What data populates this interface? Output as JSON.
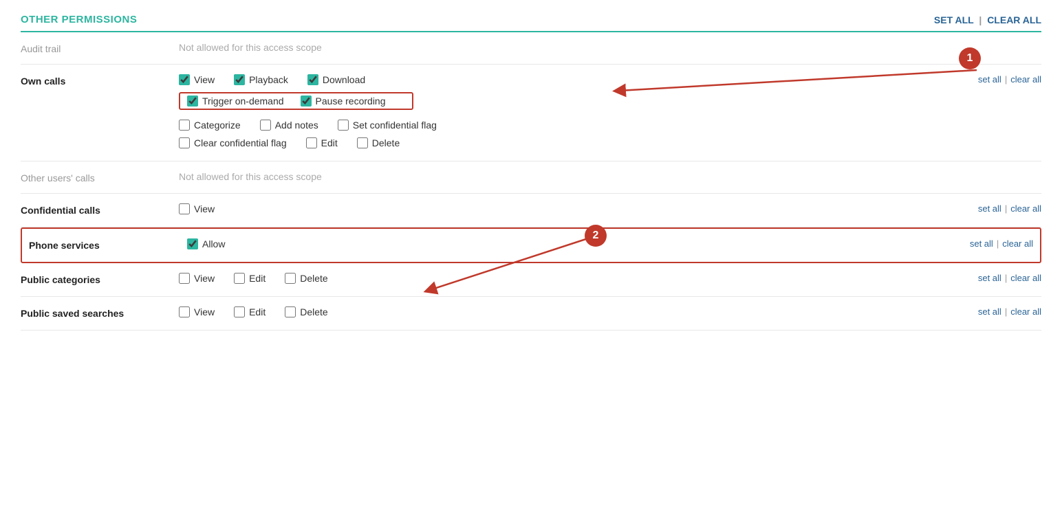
{
  "section": {
    "title": "OTHER PERMISSIONS",
    "set_all_label": "SET ALL",
    "clear_all_label": "CLEAR ALL",
    "divider": "|"
  },
  "rows": [
    {
      "id": "audit-trail",
      "label": "Audit trail",
      "label_style": "muted",
      "not_allowed": true,
      "not_allowed_text": "Not allowed for this access scope",
      "checkboxes": [],
      "has_actions": false
    },
    {
      "id": "own-calls",
      "label": "Own calls",
      "label_style": "bold",
      "not_allowed": false,
      "checkboxes": [
        {
          "id": "oc-view",
          "label": "View",
          "checked": true
        },
        {
          "id": "oc-playback",
          "label": "Playback",
          "checked": true
        },
        {
          "id": "oc-download",
          "label": "Download",
          "checked": true
        },
        {
          "id": "oc-trigger",
          "label": "Trigger on-demand",
          "checked": true,
          "highlight": true
        },
        {
          "id": "oc-pause",
          "label": "Pause recording",
          "checked": true,
          "highlight": true
        },
        {
          "id": "oc-categorize",
          "label": "Categorize",
          "checked": false
        },
        {
          "id": "oc-addnotes",
          "label": "Add notes",
          "checked": false
        },
        {
          "id": "oc-setconfidential",
          "label": "Set confidential flag",
          "checked": false
        },
        {
          "id": "oc-clearconfidential",
          "label": "Clear confidential flag",
          "checked": false
        },
        {
          "id": "oc-edit",
          "label": "Edit",
          "checked": false
        },
        {
          "id": "oc-delete",
          "label": "Delete",
          "checked": false
        }
      ],
      "has_actions": true,
      "set_all": "set all",
      "clear_all": "clear all"
    },
    {
      "id": "other-users-calls",
      "label": "Other users' calls",
      "label_style": "muted",
      "not_allowed": true,
      "not_allowed_text": "Not allowed for this access scope",
      "checkboxes": [],
      "has_actions": false
    },
    {
      "id": "confidential-calls",
      "label": "Confidential calls",
      "label_style": "bold",
      "not_allowed": false,
      "checkboxes": [
        {
          "id": "cc-view",
          "label": "View",
          "checked": false
        }
      ],
      "has_actions": true,
      "set_all": "set all",
      "clear_all": "clear all"
    },
    {
      "id": "phone-services",
      "label": "Phone services",
      "label_style": "bold",
      "not_allowed": false,
      "checkboxes": [
        {
          "id": "ps-allow",
          "label": "Allow",
          "checked": true,
          "highlight": true
        }
      ],
      "has_actions": true,
      "set_all": "set all",
      "clear_all": "clear all",
      "row_highlight": true
    },
    {
      "id": "public-categories",
      "label": "Public categories",
      "label_style": "bold",
      "not_allowed": false,
      "checkboxes": [
        {
          "id": "pc-view",
          "label": "View",
          "checked": false
        },
        {
          "id": "pc-edit",
          "label": "Edit",
          "checked": false
        },
        {
          "id": "pc-delete",
          "label": "Delete",
          "checked": false
        }
      ],
      "has_actions": true,
      "set_all": "set all",
      "clear_all": "clear all"
    },
    {
      "id": "public-saved-searches",
      "label": "Public saved searches",
      "label_style": "bold",
      "not_allowed": false,
      "checkboxes": [
        {
          "id": "pss-view",
          "label": "View",
          "checked": false
        },
        {
          "id": "pss-edit",
          "label": "Edit",
          "checked": false
        },
        {
          "id": "pss-delete",
          "label": "Delete",
          "checked": false
        }
      ],
      "has_actions": true,
      "set_all": "set all",
      "clear_all": "clear all"
    }
  ],
  "annotations": {
    "one": "1",
    "two": "2"
  }
}
